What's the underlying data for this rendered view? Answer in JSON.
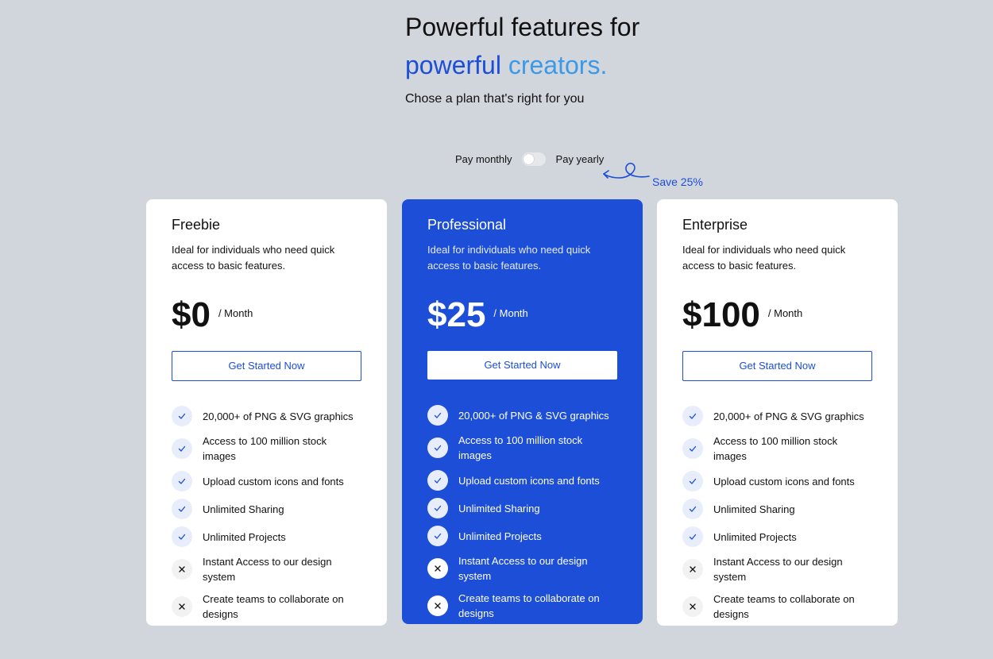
{
  "hero": {
    "title_line1": "Powerful features for",
    "title_word1": "powerful",
    "title_word2": "creators.",
    "subtitle": "Chose a plan that's right for you"
  },
  "billing": {
    "monthly_label": "Pay monthly",
    "yearly_label": "Pay yearly",
    "save_label": "Save 25%",
    "toggle_state": "monthly"
  },
  "colors": {
    "accent": "#1d4ed8",
    "accent_light": "#3b9ae8",
    "background": "#d1d5dc"
  },
  "plans": [
    {
      "name": "Freebie",
      "description": "Ideal for individuals who need quick access to basic features.",
      "price": "$0",
      "period": "/ Month",
      "cta": "Get Started Now",
      "features": [
        {
          "text": "20,000+ of PNG & SVG graphics",
          "included": true,
          "icon": "check-icon"
        },
        {
          "text": "Access to 100 million stock images",
          "included": true,
          "icon": "check-icon"
        },
        {
          "text": "Upload custom icons and fonts",
          "included": true,
          "icon": "check-icon"
        },
        {
          "text": "Unlimited Sharing",
          "included": true,
          "icon": "check-icon"
        },
        {
          "text": "Unlimited Projects",
          "included": true,
          "icon": "check-icon"
        },
        {
          "text": "Instant Access to our design system",
          "included": false,
          "icon": "x-icon"
        },
        {
          "text": "Create teams to collaborate on designs",
          "included": false,
          "icon": "x-icon"
        }
      ]
    },
    {
      "name": "Professional",
      "description": "Ideal for individuals who need quick access to basic features.",
      "price": "$25",
      "period": "/ Month",
      "cta": "Get Started Now",
      "features": [
        {
          "text": "20,000+ of PNG & SVG graphics",
          "included": true,
          "icon": "check-icon"
        },
        {
          "text": "Access to 100 million stock images",
          "included": true,
          "icon": "check-icon"
        },
        {
          "text": "Upload custom icons and fonts",
          "included": true,
          "icon": "check-icon"
        },
        {
          "text": "Unlimited Sharing",
          "included": true,
          "icon": "check-icon"
        },
        {
          "text": "Unlimited Projects",
          "included": true,
          "icon": "check-icon"
        },
        {
          "text": "Instant Access to our design system",
          "included": false,
          "icon": "x-icon"
        },
        {
          "text": "Create teams to collaborate on designs",
          "included": false,
          "icon": "x-icon"
        }
      ]
    },
    {
      "name": "Enterprise",
      "description": "Ideal for individuals who need quick access to basic features.",
      "price": "$100",
      "period": "/ Month",
      "cta": "Get Started Now",
      "features": [
        {
          "text": "20,000+ of PNG & SVG graphics",
          "included": true,
          "icon": "check-icon"
        },
        {
          "text": "Access to 100 million stock images",
          "included": true,
          "icon": "check-icon"
        },
        {
          "text": "Upload custom icons and fonts",
          "included": true,
          "icon": "check-icon"
        },
        {
          "text": "Unlimited Sharing",
          "included": true,
          "icon": "check-icon"
        },
        {
          "text": "Unlimited Projects",
          "included": true,
          "icon": "check-icon"
        },
        {
          "text": "Instant Access to our design system",
          "included": false,
          "icon": "x-icon"
        },
        {
          "text": "Create teams to collaborate on designs",
          "included": false,
          "icon": "x-icon"
        }
      ]
    }
  ]
}
